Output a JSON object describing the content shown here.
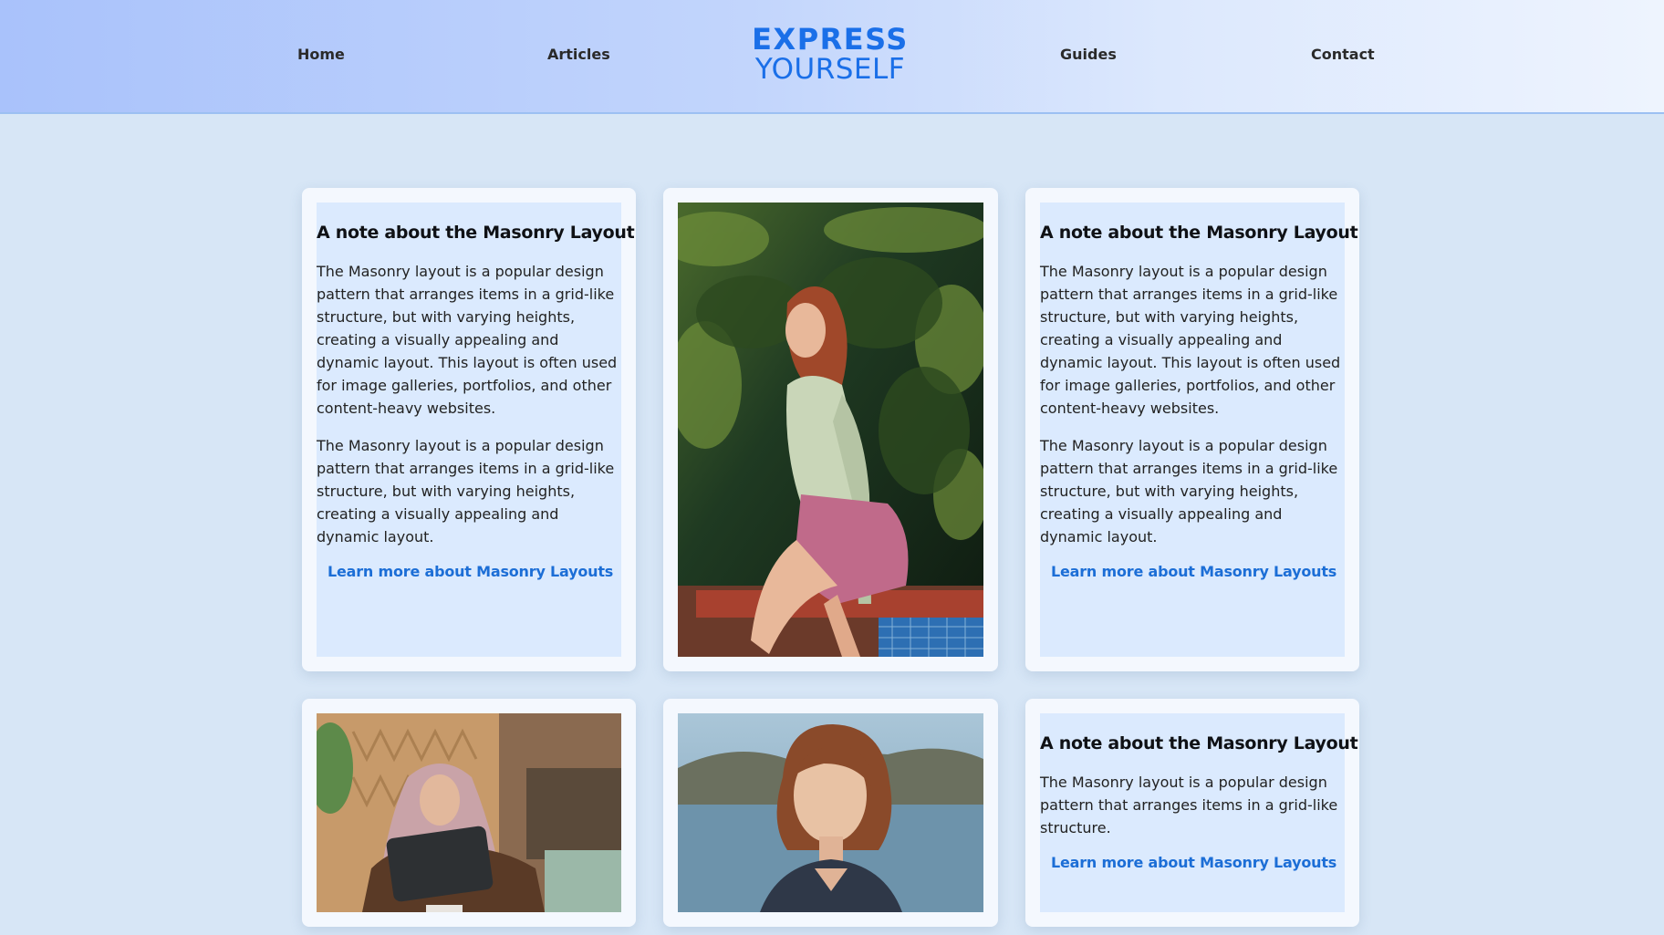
{
  "header": {
    "nav_left": [
      "Home",
      "Articles"
    ],
    "nav_right": [
      "Guides",
      "Contact"
    ],
    "logo_line1": "EXPRESS",
    "logo_line2": "YOURSELF",
    "accent_color": "#1a6fe8"
  },
  "cards": {
    "card1": {
      "title": "A note about the Masonry Layout",
      "para1": "The Masonry layout is a popular design pattern that arranges items in a grid-like structure, but with varying heights, creating a visually appealing and dynamic layout. This layout is often used for image galleries, portfolios, and other content-heavy websites.",
      "para2": "The Masonry layout is a popular design pattern that arranges items in a grid-like structure, but with varying heights, creating a visually appealing and dynamic layout.",
      "link": "Learn more about Masonry Layouts"
    },
    "card2": {
      "image": "woman-sitting-under-pine-tree-photo"
    },
    "card3": {
      "title": "A note about the Masonry Layout",
      "para1": "The Masonry layout is a popular design pattern that arranges items in a grid-like structure, but with varying heights, creating a visually appealing and dynamic layout. This layout is often used for image galleries, portfolios, and other content-heavy websites.",
      "para2": "The Masonry layout is a popular design pattern that arranges items in a grid-like structure, but with varying heights, creating a visually appealing and dynamic layout.",
      "link": "Learn more about Masonry Layouts"
    },
    "card4": {
      "image": "woman-in-hijab-holding-laptop-photo"
    },
    "card5": {
      "image": "woman-portrait-by-lake-photo"
    },
    "card6": {
      "title": "A note about the Masonry Layout",
      "para1": "The Masonry layout is a popular design pattern that arranges items in a grid-like structure.",
      "link": "Learn more about Masonry Layouts"
    }
  }
}
